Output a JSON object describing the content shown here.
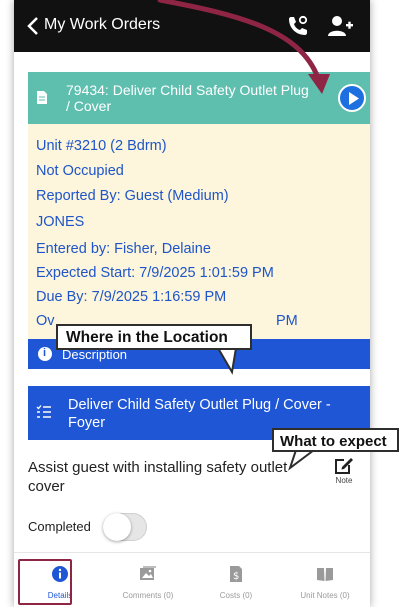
{
  "header": {
    "title": "My Work Orders",
    "back_icon": "chevron-left-icon",
    "call_icon": "phone-call-icon",
    "add_user_icon": "add-user-icon",
    "background": "#111111"
  },
  "work_order": {
    "title": "79434: Deliver Child Safety Outlet Plug / Cover",
    "bar_color": "#5fbfaf",
    "play_button_color": "#1e6fe0"
  },
  "details": {
    "unit": "Unit #3210 (2 Bdrm)",
    "occupancy": "Not Occupied",
    "reported_by": "Reported By: Guest  (Medium)",
    "name": "JONES",
    "entered_by": "Entered by: Fisher, Delaine",
    "expected_start": "Expected Start: 7/9/2025 1:01:59 PM",
    "due_by": "Due By: 7/9/2025 1:16:59 PM",
    "overdue_prefix": "Ov",
    "overdue_suffix": "PM",
    "text_color": "#1e55c8",
    "background": "#fdf5dc"
  },
  "description_section": {
    "label": "Description",
    "color": "#1e56d6"
  },
  "task": {
    "title": "Deliver Child Safety Outlet Plug / Cover - Foyer",
    "description": "Assist guest with installing safety outlet cover",
    "note_label": "Note",
    "completed_label": "Completed",
    "completed": false
  },
  "bottom_nav": {
    "tabs": [
      {
        "label": "Details",
        "icon": "info-icon",
        "active": true
      },
      {
        "label": "Comments (0)",
        "icon": "image-icon",
        "active": false
      },
      {
        "label": "Costs (0)",
        "icon": "dollar-document-icon",
        "active": false
      },
      {
        "label": "Unit Notes (0)",
        "icon": "book-icon",
        "active": false
      }
    ]
  },
  "annotations": {
    "location_callout": "Where in the Location",
    "expect_callout": "What to expect",
    "highlight_color": "#8f2544"
  }
}
